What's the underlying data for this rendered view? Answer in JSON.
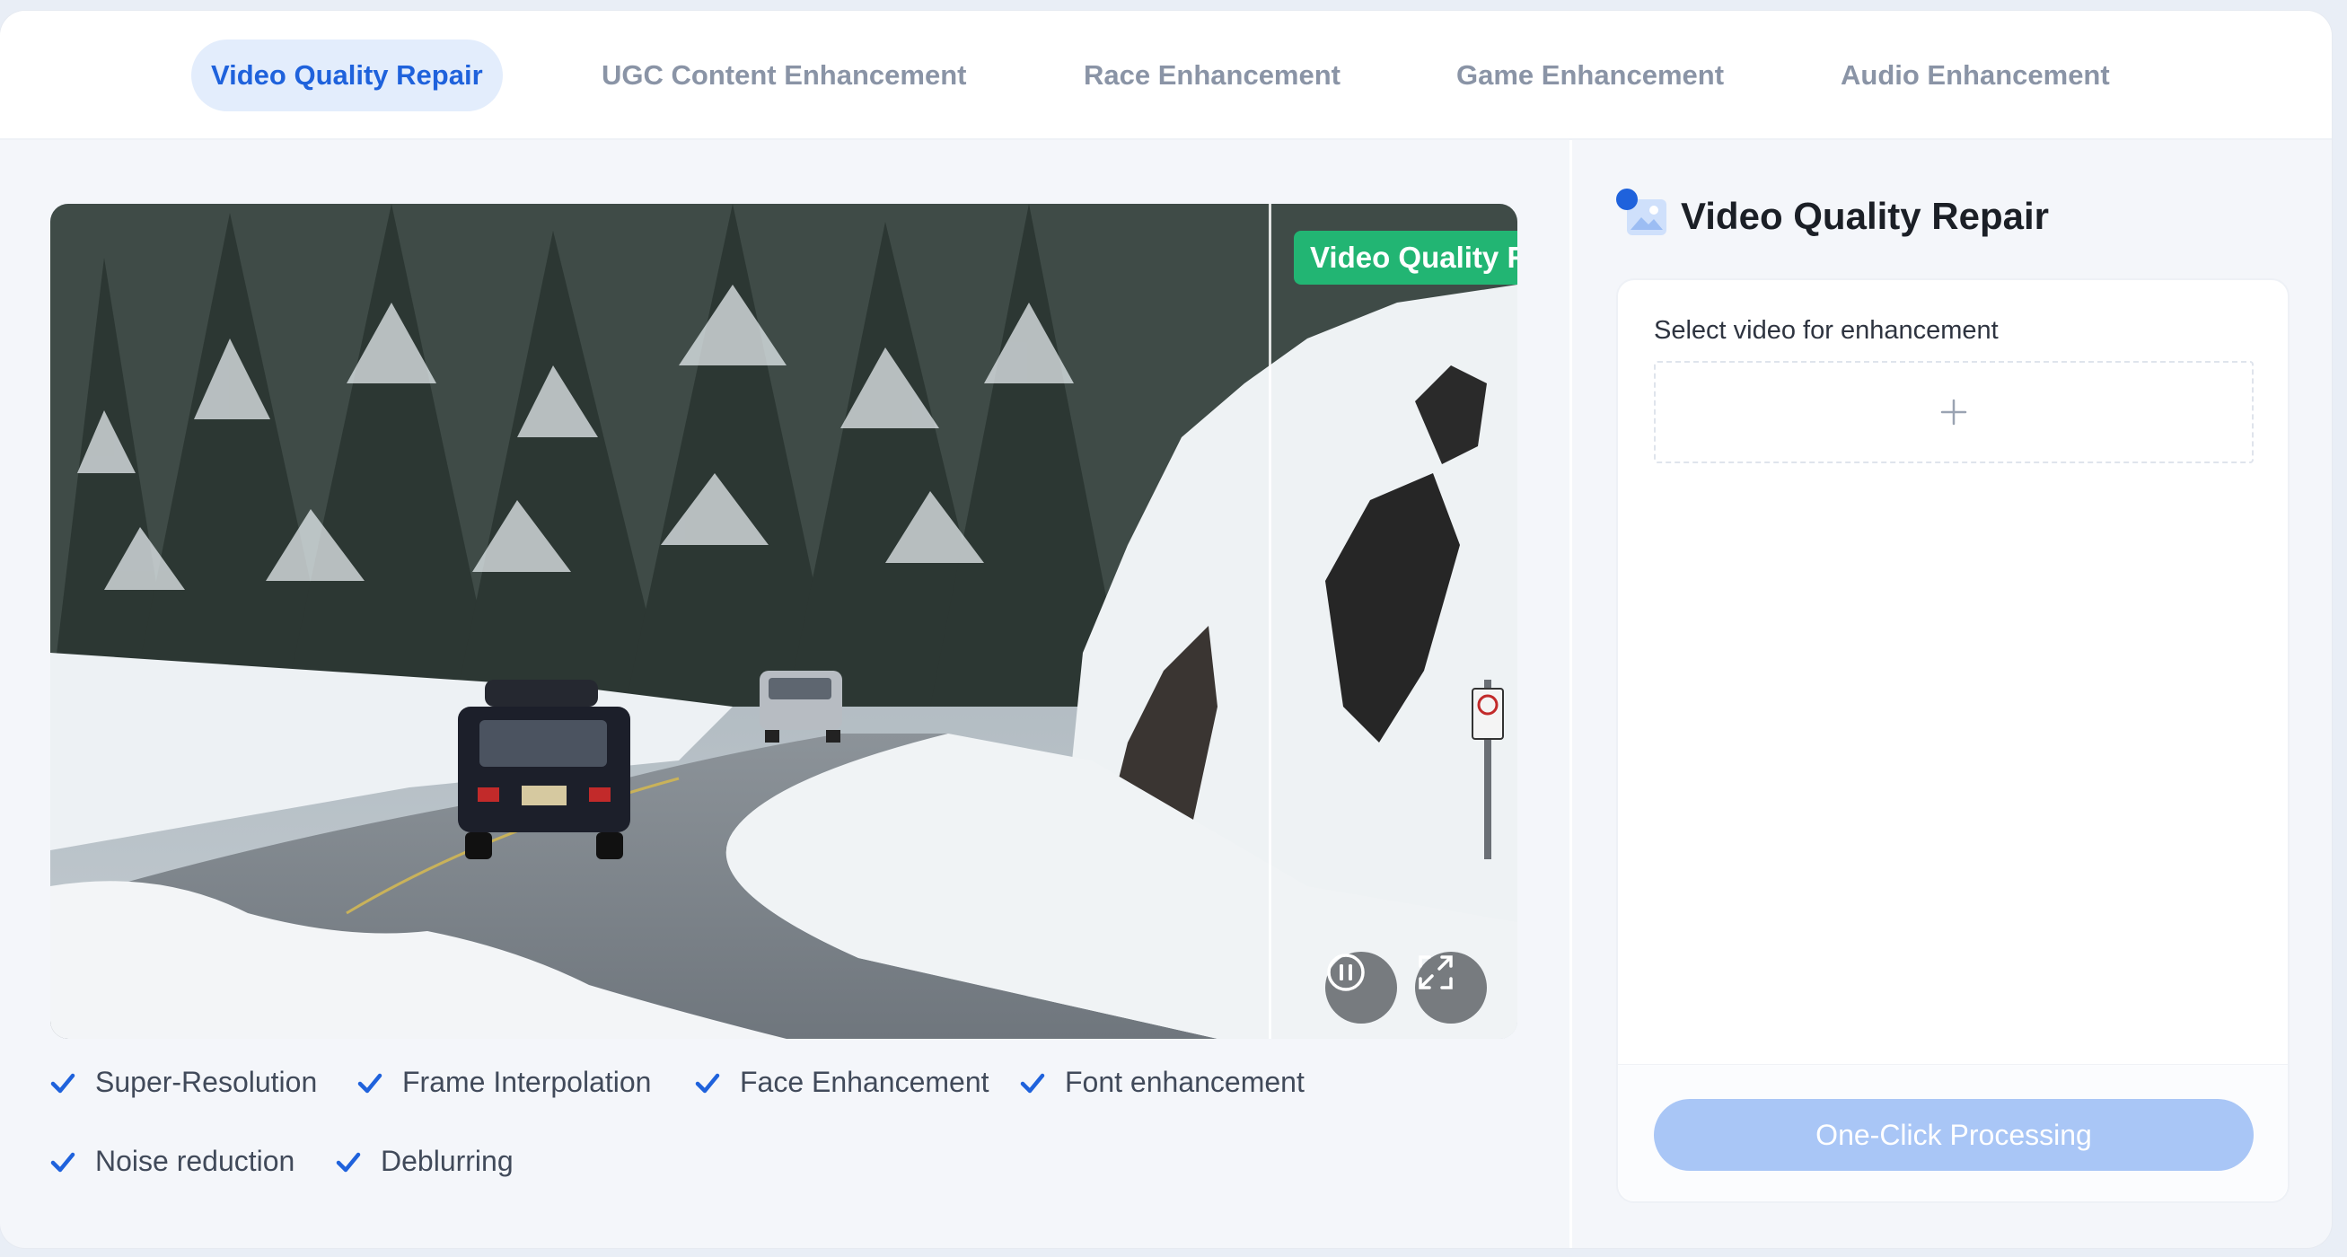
{
  "tabs": [
    {
      "label": "Video Quality Repair",
      "active": true
    },
    {
      "label": "UGC Content Enhancement",
      "active": false
    },
    {
      "label": "Race Enhancement",
      "active": false
    },
    {
      "label": "Game Enhancement",
      "active": false
    },
    {
      "label": "Audio Enhancement",
      "active": false
    }
  ],
  "video": {
    "badge": "Video Quality Repair",
    "controls": [
      {
        "icon": "pause-icon"
      },
      {
        "icon": "fullscreen-icon"
      }
    ]
  },
  "features": [
    "Super-Resolution",
    "Frame Interpolation",
    "Face Enhancement",
    "Font enhancement",
    "Noise reduction",
    "Deblurring"
  ],
  "sidebar": {
    "title": "Video Quality Repair",
    "select_label": "Select video for enhancement",
    "upload_icon": "plus-icon",
    "process_button": "One-Click Processing"
  },
  "colors": {
    "accent": "#1f62dc",
    "active_tab_bg": "#e3edfc",
    "badge_green": "#22b573",
    "button_disabled": "#a9c6f6",
    "check_blue": "#1f62dc"
  }
}
